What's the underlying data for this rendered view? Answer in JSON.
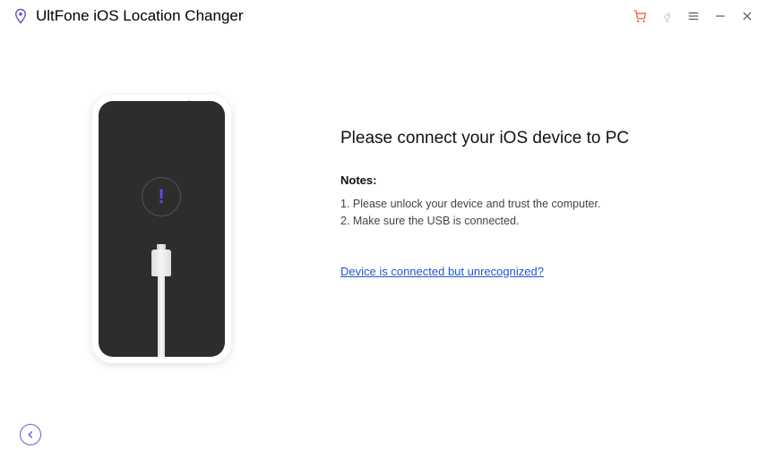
{
  "app": {
    "title": "UltFone iOS Location Changer"
  },
  "main": {
    "heading": "Please connect your iOS device to PC",
    "notes_label": "Notes:",
    "note1": "1. Please unlock your device and trust the computer.",
    "note2": "2. Make sure the USB is connected.",
    "help_link": "Device is connected but unrecognized?"
  }
}
